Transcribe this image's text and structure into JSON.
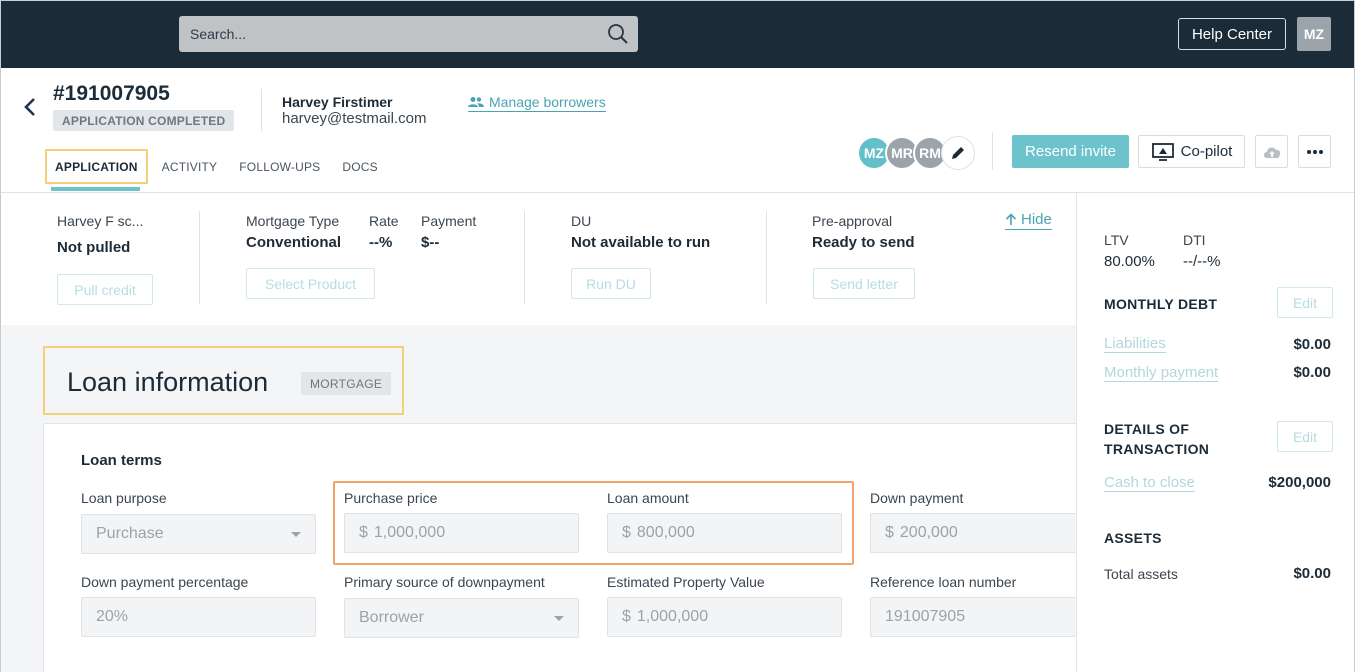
{
  "topbar": {
    "search_placeholder": "Search...",
    "help_center": "Help Center",
    "user_initials": "MZ"
  },
  "header": {
    "loan_number": "#191007905",
    "status": "APPLICATION COMPLETED",
    "borrower_name": "Harvey Firstimer",
    "borrower_email": "harvey@testmail.com",
    "manage_borrowers": "Manage borrowers",
    "tabs": [
      "APPLICATION",
      "ACTIVITY",
      "FOLLOW-UPS",
      "DOCS"
    ],
    "active_tab": "APPLICATION",
    "team_avatars": [
      "MZ",
      "MR",
      "RM"
    ],
    "resend_invite": "Resend invite",
    "copilot": "Co-pilot"
  },
  "summary": {
    "credit_label": "Harvey F sc...",
    "credit_value": "Not pulled",
    "pull_credit": "Pull credit",
    "mortgage_type_label": "Mortgage Type",
    "mortgage_type_value": "Conventional",
    "rate_label": "Rate",
    "rate_value": "--%",
    "payment_label": "Payment",
    "payment_value": "$--",
    "select_product": "Select Product",
    "du_label": "DU",
    "du_value": "Not available to run",
    "run_du": "Run DU",
    "preapproval_label": "Pre-approval",
    "preapproval_value": "Ready to send",
    "send_letter": "Send letter",
    "hide": "Hide"
  },
  "loan_info": {
    "title": "Loan information",
    "badge": "MORTGAGE",
    "section": "Loan terms",
    "fields": {
      "loan_purpose": {
        "label": "Loan purpose",
        "value": "Purchase"
      },
      "purchase_price": {
        "label": "Purchase price",
        "value": "1,000,000"
      },
      "loan_amount": {
        "label": "Loan amount",
        "value": "800,000"
      },
      "down_payment": {
        "label": "Down payment",
        "value": "200,000"
      },
      "down_payment_pct": {
        "label": "Down payment percentage",
        "value": "20%"
      },
      "primary_source": {
        "label": "Primary source of downpayment",
        "value": "Borrower"
      },
      "est_property_value": {
        "label": "Estimated Property Value",
        "value": "1,000,000"
      },
      "reference_loan_number": {
        "label": "Reference loan number",
        "value": "191007905"
      }
    },
    "currency_symbol": "$"
  },
  "right_panel": {
    "ltv_label": "LTV",
    "ltv_value": "80.00%",
    "dti_label": "DTI",
    "dti_value": "--/--%",
    "monthly_debt_heading": "MONTHLY DEBT",
    "edit": "Edit",
    "liabilities_label": "Liabilities",
    "liabilities_value": "$0.00",
    "monthly_payment_label": "Monthly payment",
    "monthly_payment_value": "$0.00",
    "details_heading_line1": "DETAILS OF",
    "details_heading_line2": "TRANSACTION",
    "cash_to_close_label": "Cash to close",
    "cash_to_close_value": "$200,000",
    "assets_heading": "ASSETS",
    "total_assets_label": "Total assets",
    "total_assets_value": "$0.00"
  }
}
